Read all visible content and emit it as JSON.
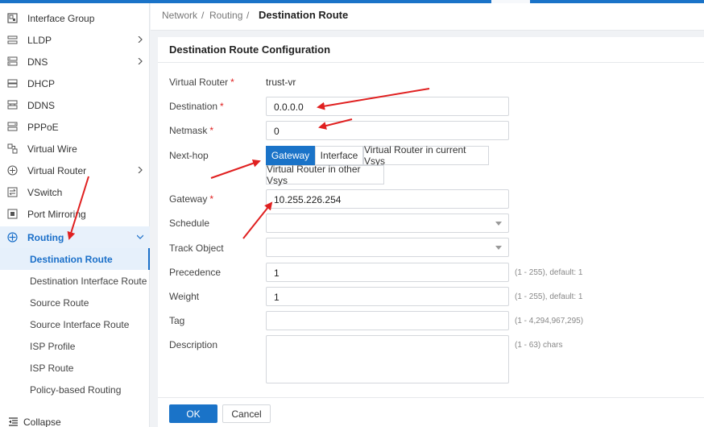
{
  "breadcrumb": {
    "part1": "Network",
    "sep1": "/",
    "part2": "Routing",
    "sep2": "/",
    "current": "Destination Route"
  },
  "sidebar": {
    "items": [
      {
        "label": "Interface Group",
        "icon": "interface-group-icon",
        "has_children": false
      },
      {
        "label": "LLDP",
        "icon": "lldp-icon",
        "has_children": true
      },
      {
        "label": "DNS",
        "icon": "dns-icon",
        "has_children": true
      },
      {
        "label": "DHCP",
        "icon": "dhcp-icon",
        "has_children": false
      },
      {
        "label": "DDNS",
        "icon": "ddns-icon",
        "has_children": false
      },
      {
        "label": "PPPoE",
        "icon": "pppoe-icon",
        "has_children": false
      },
      {
        "label": "Virtual Wire",
        "icon": "virtual-wire-icon",
        "has_children": false
      },
      {
        "label": "Virtual Router",
        "icon": "virtual-router-icon",
        "has_children": true
      },
      {
        "label": "VSwitch",
        "icon": "vswitch-icon",
        "has_children": false
      },
      {
        "label": "Port Mirroring",
        "icon": "port-mirroring-icon",
        "has_children": false
      },
      {
        "label": "Routing",
        "icon": "routing-icon",
        "has_children": true,
        "expanded": true
      }
    ],
    "routing_children": [
      {
        "label": "Destination Route",
        "active": true
      },
      {
        "label": "Destination Interface Route"
      },
      {
        "label": "Source Route"
      },
      {
        "label": "Source Interface Route"
      },
      {
        "label": "ISP Profile"
      },
      {
        "label": "ISP Route"
      },
      {
        "label": "Policy-based Routing"
      }
    ],
    "collapse_label": "Collapse"
  },
  "form": {
    "title": "Destination Route Configuration",
    "virtual_router": {
      "label": "Virtual Router",
      "value": "trust-vr"
    },
    "destination": {
      "label": "Destination",
      "value": "0.0.0.0"
    },
    "netmask": {
      "label": "Netmask",
      "value": "0"
    },
    "nexthop": {
      "label": "Next-hop",
      "options": [
        "Gateway",
        "Interface",
        "Virtual Router in current Vsys",
        "Virtual Router in other Vsys"
      ],
      "selected": "Gateway"
    },
    "gateway": {
      "label": "Gateway",
      "value": "10.255.226.254"
    },
    "schedule": {
      "label": "Schedule",
      "value": ""
    },
    "track_object": {
      "label": "Track Object",
      "value": ""
    },
    "precedence": {
      "label": "Precedence",
      "value": "1",
      "hint": "(1 - 255), default: 1"
    },
    "weight": {
      "label": "Weight",
      "value": "1",
      "hint": "(1 - 255), default: 1"
    },
    "tag": {
      "label": "Tag",
      "value": "",
      "hint": "(1 - 4,294,967,295)"
    },
    "description": {
      "label": "Description",
      "value": "",
      "hint": "(1 - 63) chars"
    },
    "required_mark": "*"
  },
  "buttons": {
    "ok": "OK",
    "cancel": "Cancel"
  },
  "colors": {
    "accent": "#1a73c8",
    "annotation_arrow": "#e02020",
    "required": "#e02020"
  }
}
